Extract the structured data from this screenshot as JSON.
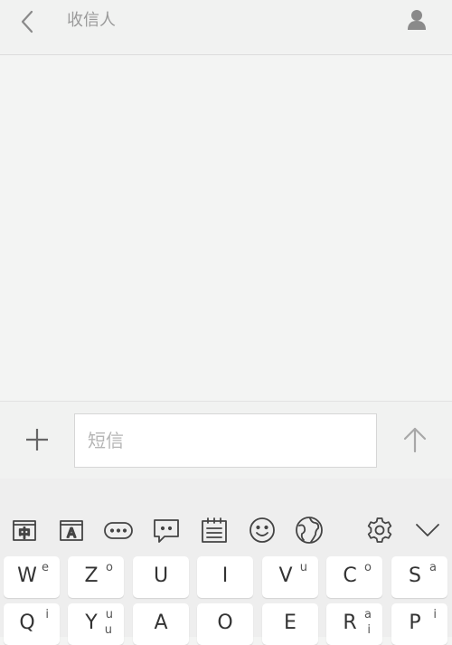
{
  "header": {
    "title": "收信人",
    "back_icon": "chevron-left-icon",
    "contact_icon": "person-icon"
  },
  "compose": {
    "placeholder": "短信",
    "value": "",
    "add_icon": "plus-icon",
    "send_icon": "arrow-up-icon"
  },
  "keyboard": {
    "toolbar": [
      {
        "name": "chinese-mode-icon",
        "label": "中"
      },
      {
        "name": "english-mode-icon",
        "label": "A"
      },
      {
        "name": "more-icon"
      },
      {
        "name": "quick-reply-icon"
      },
      {
        "name": "clipboard-icon"
      },
      {
        "name": "emoji-icon"
      },
      {
        "name": "globe-icon"
      },
      {
        "name": "gear-icon"
      },
      {
        "name": "chevron-down-icon"
      }
    ],
    "row1": [
      {
        "main": "W",
        "sup": "e"
      },
      {
        "main": "Z",
        "sup": "o"
      },
      {
        "main": "U",
        "sup": ""
      },
      {
        "main": "I",
        "sup": ""
      },
      {
        "main": "V",
        "sup": "u"
      },
      {
        "main": "C",
        "sup": "o"
      },
      {
        "main": "S",
        "sup": "a"
      }
    ],
    "row2": [
      {
        "main": "Q",
        "sup": "i",
        "sub": ""
      },
      {
        "main": "Y",
        "sup": "u",
        "sub": "u"
      },
      {
        "main": "A",
        "sup": "",
        "sub": ""
      },
      {
        "main": "O",
        "sup": "",
        "sub": ""
      },
      {
        "main": "E",
        "sup": "",
        "sub": ""
      },
      {
        "main": "R",
        "sup": "a",
        "sub": "i"
      },
      {
        "main": "P",
        "sup": "i",
        "sub": ""
      }
    ]
  },
  "colors": {
    "background": "#f3f4f3",
    "header": "#f1f2f1",
    "title_text": "#9a9a9a",
    "icon": "#8c8c8c",
    "key": "#ffffff"
  }
}
